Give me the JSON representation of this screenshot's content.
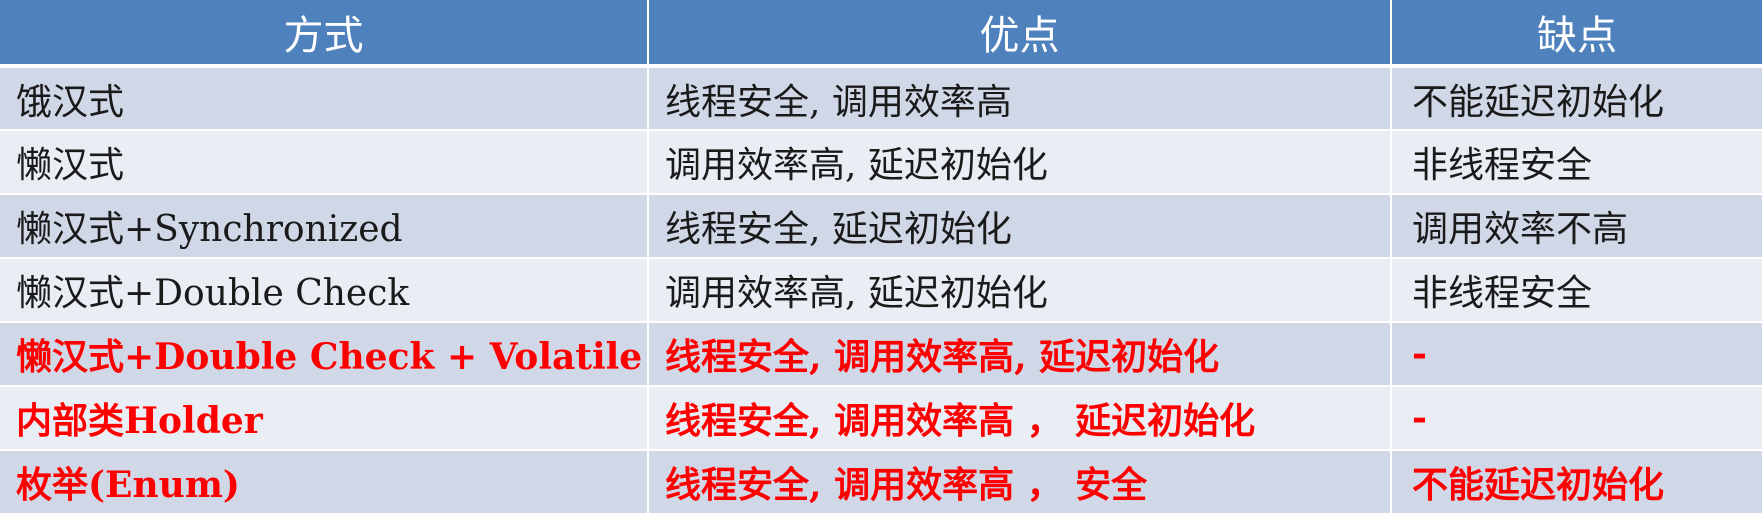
{
  "table": {
    "headers": [
      "方式",
      "优点",
      "缺点"
    ],
    "rows": [
      {
        "method": "饿汉式",
        "pros": "线程安全, 调用效率高",
        "cons": "不能延迟初始化",
        "method_red": false,
        "pros_red": false,
        "cons_red": false
      },
      {
        "method": "懒汉式",
        "pros": "调用效率高, 延迟初始化",
        "cons": "非线程安全",
        "method_red": false,
        "pros_red": false,
        "cons_red": false
      },
      {
        "method": "懒汉式+Synchronized",
        "pros": "线程安全, 延迟初始化",
        "cons": "调用效率不高",
        "method_red": false,
        "pros_red": false,
        "cons_red": false
      },
      {
        "method": "懒汉式+Double Check",
        "pros": "调用效率高, 延迟初始化",
        "cons": "非线程安全",
        "method_red": false,
        "pros_red": false,
        "cons_red": false
      },
      {
        "method": "懒汉式+Double Check + Volatile",
        "pros": "线程安全, 调用效率高, 延迟初始化",
        "cons": "-",
        "method_red": true,
        "pros_red": true,
        "cons_red": true
      },
      {
        "method": "内部类Holder",
        "pros": "线程安全, 调用效率高 ， 延迟初始化",
        "cons": "-",
        "method_red": true,
        "pros_red": true,
        "cons_red": true
      },
      {
        "method": "枚举(Enum)",
        "pros": "线程安全, 调用效率高 ， 安全",
        "cons": "不能延迟初始化",
        "method_red": true,
        "pros_red": true,
        "cons_red": true
      }
    ]
  },
  "colors": {
    "header_bg": "#4f81bd",
    "row_odd_bg": "#d0d8e8",
    "row_even_bg": "#e9edf4",
    "highlight_text": "#ff0000",
    "normal_text": "#1a1a1a"
  }
}
